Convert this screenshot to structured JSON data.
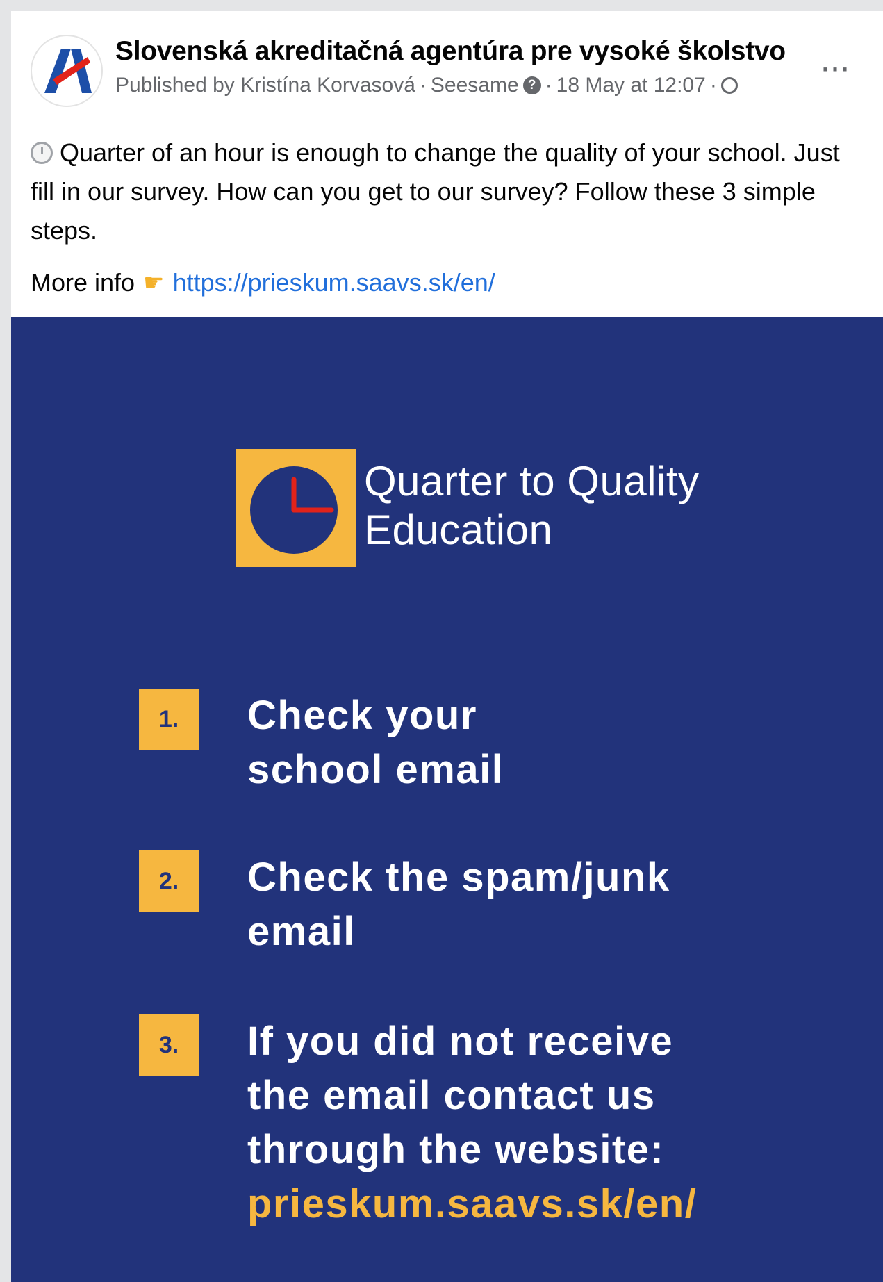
{
  "post": {
    "page_name": "Slovenská akreditačná agentúra pre vysoké školstvo",
    "published_by": "Published by Kristína Korvasová",
    "separator": "·",
    "tool": "Seesame",
    "date": "18 May at 12:07",
    "more_icon": "more-options-icon",
    "text": "Quarter of an hour is enough to change the quality of your school. Just fill in our survey. How can you get to our survey? Follow these 3 simple steps.",
    "more_info_label": "More info",
    "link": "https://prieskum.saavs.sk/en/"
  },
  "infographic": {
    "title_line1": "Quarter to Quality",
    "title_line2": "Education",
    "steps": [
      {
        "number": "1.",
        "lines": [
          "Check your",
          "school email"
        ]
      },
      {
        "number": "2.",
        "lines": [
          "Check the spam/junk",
          "email"
        ]
      },
      {
        "number": "3.",
        "lines": [
          "If you did not receive",
          "the email contact us",
          "through the website:"
        ],
        "url": "prieskum.saavs.sk/en/"
      }
    ]
  },
  "colors": {
    "navy": "#22337b",
    "yellow": "#f6b740",
    "link_blue": "#216fdb",
    "logo_red": "#e2231a",
    "logo_blue": "#1d4fa8"
  }
}
